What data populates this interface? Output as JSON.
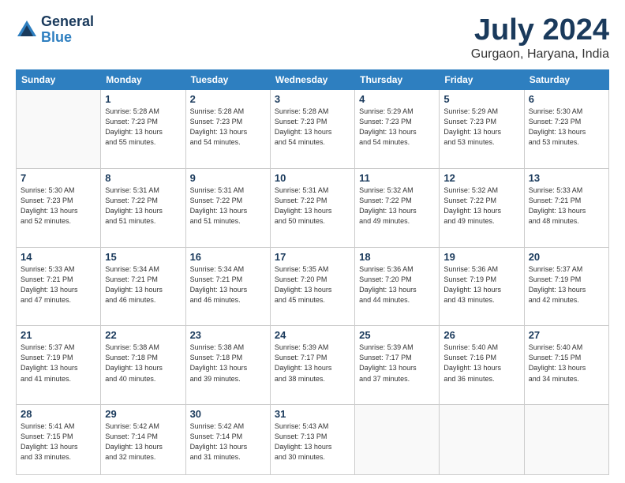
{
  "header": {
    "logo_line1": "General",
    "logo_line2": "Blue",
    "month_title": "July 2024",
    "location": "Gurgaon, Haryana, India"
  },
  "days_of_week": [
    "Sunday",
    "Monday",
    "Tuesday",
    "Wednesday",
    "Thursday",
    "Friday",
    "Saturday"
  ],
  "weeks": [
    [
      {
        "day": "",
        "info": ""
      },
      {
        "day": "1",
        "info": "Sunrise: 5:28 AM\nSunset: 7:23 PM\nDaylight: 13 hours\nand 55 minutes."
      },
      {
        "day": "2",
        "info": "Sunrise: 5:28 AM\nSunset: 7:23 PM\nDaylight: 13 hours\nand 54 minutes."
      },
      {
        "day": "3",
        "info": "Sunrise: 5:28 AM\nSunset: 7:23 PM\nDaylight: 13 hours\nand 54 minutes."
      },
      {
        "day": "4",
        "info": "Sunrise: 5:29 AM\nSunset: 7:23 PM\nDaylight: 13 hours\nand 54 minutes."
      },
      {
        "day": "5",
        "info": "Sunrise: 5:29 AM\nSunset: 7:23 PM\nDaylight: 13 hours\nand 53 minutes."
      },
      {
        "day": "6",
        "info": "Sunrise: 5:30 AM\nSunset: 7:23 PM\nDaylight: 13 hours\nand 53 minutes."
      }
    ],
    [
      {
        "day": "7",
        "info": "Sunrise: 5:30 AM\nSunset: 7:23 PM\nDaylight: 13 hours\nand 52 minutes."
      },
      {
        "day": "8",
        "info": "Sunrise: 5:31 AM\nSunset: 7:22 PM\nDaylight: 13 hours\nand 51 minutes."
      },
      {
        "day": "9",
        "info": "Sunrise: 5:31 AM\nSunset: 7:22 PM\nDaylight: 13 hours\nand 51 minutes."
      },
      {
        "day": "10",
        "info": "Sunrise: 5:31 AM\nSunset: 7:22 PM\nDaylight: 13 hours\nand 50 minutes."
      },
      {
        "day": "11",
        "info": "Sunrise: 5:32 AM\nSunset: 7:22 PM\nDaylight: 13 hours\nand 49 minutes."
      },
      {
        "day": "12",
        "info": "Sunrise: 5:32 AM\nSunset: 7:22 PM\nDaylight: 13 hours\nand 49 minutes."
      },
      {
        "day": "13",
        "info": "Sunrise: 5:33 AM\nSunset: 7:21 PM\nDaylight: 13 hours\nand 48 minutes."
      }
    ],
    [
      {
        "day": "14",
        "info": "Sunrise: 5:33 AM\nSunset: 7:21 PM\nDaylight: 13 hours\nand 47 minutes."
      },
      {
        "day": "15",
        "info": "Sunrise: 5:34 AM\nSunset: 7:21 PM\nDaylight: 13 hours\nand 46 minutes."
      },
      {
        "day": "16",
        "info": "Sunrise: 5:34 AM\nSunset: 7:21 PM\nDaylight: 13 hours\nand 46 minutes."
      },
      {
        "day": "17",
        "info": "Sunrise: 5:35 AM\nSunset: 7:20 PM\nDaylight: 13 hours\nand 45 minutes."
      },
      {
        "day": "18",
        "info": "Sunrise: 5:36 AM\nSunset: 7:20 PM\nDaylight: 13 hours\nand 44 minutes."
      },
      {
        "day": "19",
        "info": "Sunrise: 5:36 AM\nSunset: 7:19 PM\nDaylight: 13 hours\nand 43 minutes."
      },
      {
        "day": "20",
        "info": "Sunrise: 5:37 AM\nSunset: 7:19 PM\nDaylight: 13 hours\nand 42 minutes."
      }
    ],
    [
      {
        "day": "21",
        "info": "Sunrise: 5:37 AM\nSunset: 7:19 PM\nDaylight: 13 hours\nand 41 minutes."
      },
      {
        "day": "22",
        "info": "Sunrise: 5:38 AM\nSunset: 7:18 PM\nDaylight: 13 hours\nand 40 minutes."
      },
      {
        "day": "23",
        "info": "Sunrise: 5:38 AM\nSunset: 7:18 PM\nDaylight: 13 hours\nand 39 minutes."
      },
      {
        "day": "24",
        "info": "Sunrise: 5:39 AM\nSunset: 7:17 PM\nDaylight: 13 hours\nand 38 minutes."
      },
      {
        "day": "25",
        "info": "Sunrise: 5:39 AM\nSunset: 7:17 PM\nDaylight: 13 hours\nand 37 minutes."
      },
      {
        "day": "26",
        "info": "Sunrise: 5:40 AM\nSunset: 7:16 PM\nDaylight: 13 hours\nand 36 minutes."
      },
      {
        "day": "27",
        "info": "Sunrise: 5:40 AM\nSunset: 7:15 PM\nDaylight: 13 hours\nand 34 minutes."
      }
    ],
    [
      {
        "day": "28",
        "info": "Sunrise: 5:41 AM\nSunset: 7:15 PM\nDaylight: 13 hours\nand 33 minutes."
      },
      {
        "day": "29",
        "info": "Sunrise: 5:42 AM\nSunset: 7:14 PM\nDaylight: 13 hours\nand 32 minutes."
      },
      {
        "day": "30",
        "info": "Sunrise: 5:42 AM\nSunset: 7:14 PM\nDaylight: 13 hours\nand 31 minutes."
      },
      {
        "day": "31",
        "info": "Sunrise: 5:43 AM\nSunset: 7:13 PM\nDaylight: 13 hours\nand 30 minutes."
      },
      {
        "day": "",
        "info": ""
      },
      {
        "day": "",
        "info": ""
      },
      {
        "day": "",
        "info": ""
      }
    ]
  ]
}
